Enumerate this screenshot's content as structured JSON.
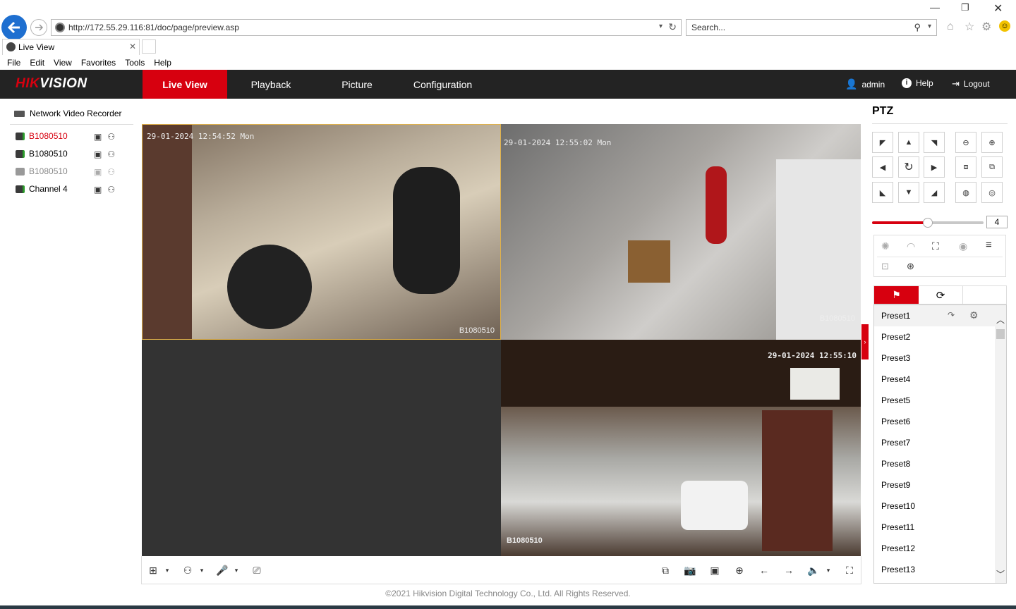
{
  "browser": {
    "url": "http://172.55.29.116:81/doc/page/preview.asp",
    "search_placeholder": "Search...",
    "tab_title": "Live View",
    "menu": [
      "File",
      "Edit",
      "View",
      "Favorites",
      "Tools",
      "Help"
    ]
  },
  "header": {
    "logo": "HIKVISION",
    "nav": [
      "Live View",
      "Playback",
      "Picture",
      "Configuration"
    ],
    "active_nav": "Live View",
    "user": "admin",
    "help": "Help",
    "logout": "Logout",
    "accent_color": "#d7000f"
  },
  "device_tree": {
    "root": "Network Video Recorder",
    "channels": [
      {
        "name": "B1080510",
        "state": "selected",
        "color": "#d7000f"
      },
      {
        "name": "B1080510",
        "state": "online",
        "color": "#000000"
      },
      {
        "name": "B1080510",
        "state": "offline",
        "color": "#888888"
      },
      {
        "name": "Channel 4",
        "state": "online",
        "color": "#000000"
      }
    ]
  },
  "videos": [
    {
      "timestamp": "29-01-2024 12:54:52 Mon",
      "label": "B1080510",
      "selected": true
    },
    {
      "timestamp": "29-01-2024 12:55:02 Mon",
      "label": "B1080510"
    },
    {
      "timestamp": "",
      "label": "",
      "empty": true
    },
    {
      "timestamp": "29-01-2024 12:55:10",
      "label": "B1080510"
    }
  ],
  "toolbar_icons": [
    "layout-icon",
    "stream-icon",
    "mic-icon",
    "screen-icon",
    "multi-icon",
    "camera-icon",
    "record-icon",
    "zoom-icon",
    "prev-icon",
    "next-icon",
    "volume-icon",
    "fullscreen-icon"
  ],
  "ptz": {
    "title": "PTZ",
    "speed": "4",
    "speed_level": 0.5,
    "presets": [
      "Preset1",
      "Preset2",
      "Preset3",
      "Preset4",
      "Preset5",
      "Preset6",
      "Preset7",
      "Preset8",
      "Preset9",
      "Preset10",
      "Preset11",
      "Preset12",
      "Preset13"
    ]
  },
  "footer": "©2021 Hikvision Digital Technology Co., Ltd. All Rights Reserved."
}
